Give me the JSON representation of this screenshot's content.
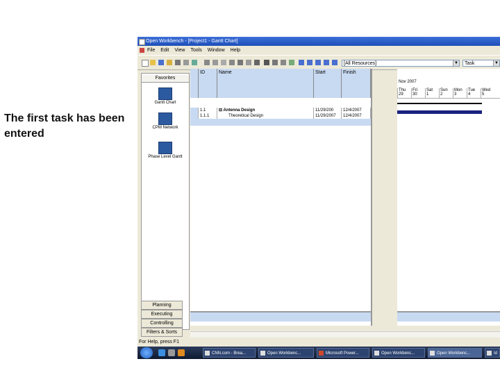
{
  "caption": {
    "line1": "The first task has been",
    "line2": "entered"
  },
  "window": {
    "title": "Open Workbench - [Project1 - Gantt Chart]"
  },
  "menu": [
    "File",
    "Edit",
    "View",
    "Tools",
    "Window",
    "Help"
  ],
  "toolbar": {
    "resource_filter": "[All Resources]",
    "task_filter": "Task"
  },
  "sidebar": {
    "title": "Favorites",
    "views": [
      "Gantt Chart",
      "CPM Network",
      "Phase Level Gantt"
    ],
    "bottom_tabs": [
      "Planning",
      "Executing",
      "Controlling",
      "Filters & Sorts"
    ]
  },
  "grid": {
    "columns": [
      "ID",
      "Name",
      "Start",
      "Finish"
    ],
    "rows": [
      {
        "id": "1.1",
        "name": "Antenna Design",
        "start": "11/29/200",
        "finish": "12/4/2007"
      },
      {
        "id": "1.1.1",
        "name": "Theoretical Design",
        "start": "11/29/2007",
        "finish": "12/4/2007"
      }
    ]
  },
  "gantt": {
    "month": "Nov 2007",
    "days": [
      {
        "name": "Thu",
        "num": "29"
      },
      {
        "name": "Fri",
        "num": "30"
      },
      {
        "name": "Sat",
        "num": "1"
      },
      {
        "name": "Sun",
        "num": "2"
      },
      {
        "name": "Mon",
        "num": "3"
      },
      {
        "name": "Tue",
        "num": "4"
      },
      {
        "name": "Wed",
        "num": "5"
      }
    ]
  },
  "status": "For Help, press F1",
  "taskbar": {
    "tasks": [
      "CNN.com - Brea...",
      "Open Workbenc...",
      "Microsoft Power...",
      "Open Workbenc...",
      "Open Workbenc...",
      "Id"
    ]
  }
}
